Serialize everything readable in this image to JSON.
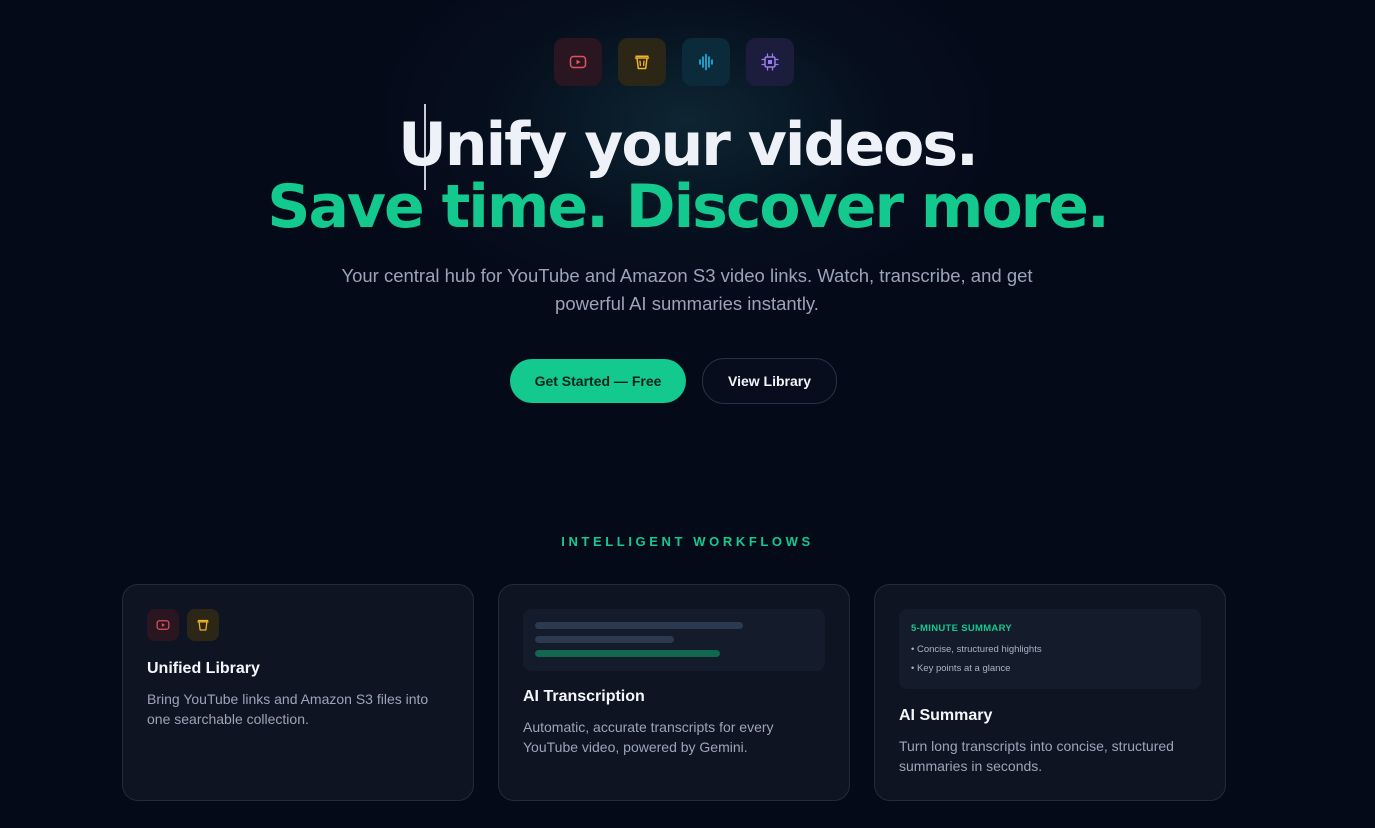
{
  "hero": {
    "icons": [
      "youtube-icon",
      "bucket-icon",
      "audio-wave-icon",
      "chip-icon"
    ],
    "headline_line1": "Unify your videos.",
    "headline_line2": "Save time. Discover more.",
    "subtitle": "Your central hub for YouTube and Amazon S3 video links. Watch, transcribe, and get powerful AI summaries instantly.",
    "primary_button": "Get Started — Free",
    "secondary_button": "View Library"
  },
  "features": {
    "section_label": "INTELLIGENT WORKFLOWS",
    "cards": [
      {
        "title": "Unified Library",
        "description": "Bring YouTube links and Amazon S3 files into one searchable collection."
      },
      {
        "title": "AI Transcription",
        "description": "Automatic, accurate transcripts for every YouTube video, powered by Gemini."
      },
      {
        "title": "AI Summary",
        "description": "Turn long transcripts into concise, structured summaries in seconds.",
        "preview_title": "5-MINUTE SUMMARY",
        "preview_items": [
          "• Concise, structured highlights",
          "• Key points at a glance"
        ]
      }
    ]
  },
  "colors": {
    "background": "#050a19",
    "accent": "#14c98e",
    "card": "#0f1422"
  }
}
